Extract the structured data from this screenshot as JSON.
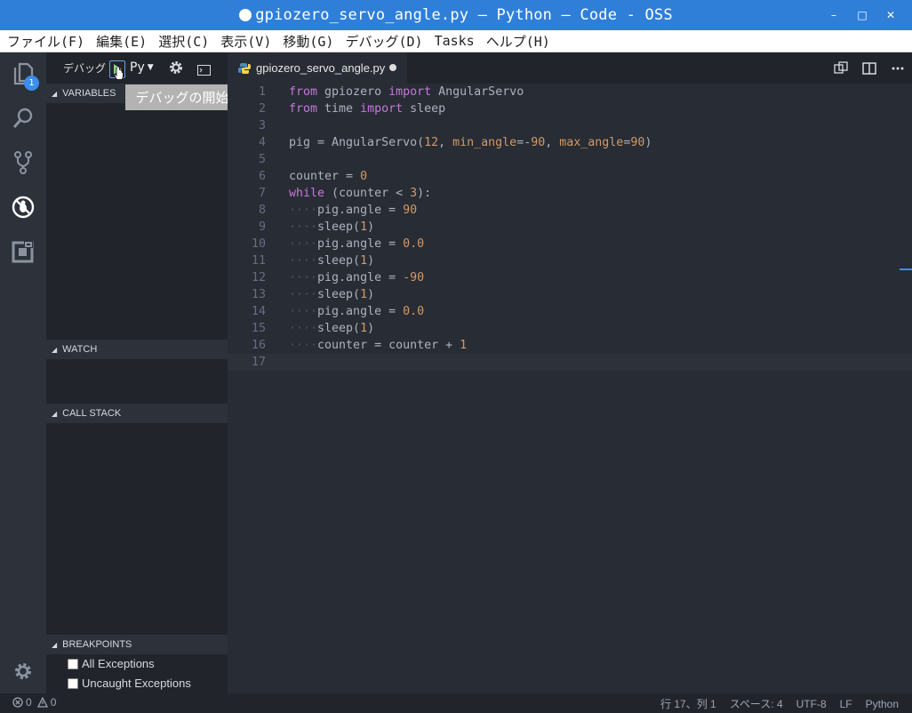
{
  "window": {
    "title": "gpiozero_servo_angle.py — Python — Code - OSS",
    "minimize": "–",
    "maximize": "□",
    "close": "✕"
  },
  "menu": [
    "ファイル(F)",
    "編集(E)",
    "選択(C)",
    "表示(V)",
    "移動(G)",
    "デバッグ(D)",
    "Tasks",
    "ヘルプ(H)"
  ],
  "activity": {
    "explorer_badge": "1"
  },
  "debug": {
    "label": "デバッグ",
    "config": "Py",
    "tooltip": "デバッグの開始",
    "sections": {
      "variables": "VARIABLES",
      "watch": "WATCH",
      "call_stack": "CALL STACK",
      "breakpoints": "BREAKPOINTS"
    },
    "breakpoints": [
      "All Exceptions",
      "Uncaught Exceptions"
    ]
  },
  "editor": {
    "tab": "gpiozero_servo_angle.py",
    "lines": [
      {
        "n": "1",
        "parts": [
          {
            "t": "from",
            "c": "kw"
          },
          {
            "t": " gpiozero ",
            "c": ""
          },
          {
            "t": "import",
            "c": "kw"
          },
          {
            "t": " AngularServo",
            "c": ""
          }
        ]
      },
      {
        "n": "2",
        "parts": [
          {
            "t": "from",
            "c": "kw"
          },
          {
            "t": " time ",
            "c": ""
          },
          {
            "t": "import",
            "c": "kw"
          },
          {
            "t": " sleep",
            "c": ""
          }
        ]
      },
      {
        "n": "3",
        "parts": []
      },
      {
        "n": "4",
        "parts": [
          {
            "t": "pig = AngularServo(",
            "c": ""
          },
          {
            "t": "12",
            "c": "num"
          },
          {
            "t": ", ",
            "c": ""
          },
          {
            "t": "min_angle",
            "c": "param"
          },
          {
            "t": "=-",
            "c": ""
          },
          {
            "t": "90",
            "c": "num"
          },
          {
            "t": ", ",
            "c": ""
          },
          {
            "t": "max_angle",
            "c": "param"
          },
          {
            "t": "=",
            "c": ""
          },
          {
            "t": "90",
            "c": "num"
          },
          {
            "t": ")",
            "c": ""
          }
        ]
      },
      {
        "n": "5",
        "parts": []
      },
      {
        "n": "6",
        "parts": [
          {
            "t": "counter = ",
            "c": ""
          },
          {
            "t": "0",
            "c": "num"
          }
        ]
      },
      {
        "n": "7",
        "parts": [
          {
            "t": "while",
            "c": "kw"
          },
          {
            "t": " (counter < ",
            "c": ""
          },
          {
            "t": "3",
            "c": "num"
          },
          {
            "t": "):",
            "c": ""
          }
        ]
      },
      {
        "n": "8",
        "parts": [
          {
            "t": "····",
            "c": "ws"
          },
          {
            "t": "pig.angle = ",
            "c": ""
          },
          {
            "t": "90",
            "c": "num"
          }
        ]
      },
      {
        "n": "9",
        "parts": [
          {
            "t": "····",
            "c": "ws"
          },
          {
            "t": "sleep(",
            "c": ""
          },
          {
            "t": "1",
            "c": "num"
          },
          {
            "t": ")",
            "c": ""
          }
        ]
      },
      {
        "n": "10",
        "parts": [
          {
            "t": "····",
            "c": "ws"
          },
          {
            "t": "pig.angle = ",
            "c": ""
          },
          {
            "t": "0.0",
            "c": "num"
          }
        ]
      },
      {
        "n": "11",
        "parts": [
          {
            "t": "····",
            "c": "ws"
          },
          {
            "t": "sleep(",
            "c": ""
          },
          {
            "t": "1",
            "c": "num"
          },
          {
            "t": ")",
            "c": ""
          }
        ]
      },
      {
        "n": "12",
        "parts": [
          {
            "t": "····",
            "c": "ws"
          },
          {
            "t": "pig.angle = ",
            "c": ""
          },
          {
            "t": "-90",
            "c": "num"
          }
        ]
      },
      {
        "n": "13",
        "parts": [
          {
            "t": "····",
            "c": "ws"
          },
          {
            "t": "sleep(",
            "c": ""
          },
          {
            "t": "1",
            "c": "num"
          },
          {
            "t": ")",
            "c": ""
          }
        ]
      },
      {
        "n": "14",
        "parts": [
          {
            "t": "····",
            "c": "ws"
          },
          {
            "t": "pig.angle = ",
            "c": ""
          },
          {
            "t": "0.0",
            "c": "num"
          }
        ]
      },
      {
        "n": "15",
        "parts": [
          {
            "t": "····",
            "c": "ws"
          },
          {
            "t": "sleep(",
            "c": ""
          },
          {
            "t": "1",
            "c": "num"
          },
          {
            "t": ")",
            "c": ""
          }
        ]
      },
      {
        "n": "16",
        "parts": [
          {
            "t": "····",
            "c": "ws"
          },
          {
            "t": "counter = counter + ",
            "c": ""
          },
          {
            "t": "1",
            "c": "num"
          }
        ]
      },
      {
        "n": "17",
        "parts": [],
        "current": true
      }
    ]
  },
  "status": {
    "errors": "0",
    "warnings": "0",
    "position": "行 17、列 1",
    "indent": "スペース: 4",
    "encoding": "UTF-8",
    "eol": "LF",
    "language": "Python"
  },
  "colors": {
    "titlebar": "#2f7fd9",
    "keyword": "#c678dd",
    "number": "#d19a66",
    "text": "#abb2bf",
    "play": "#89d185"
  }
}
